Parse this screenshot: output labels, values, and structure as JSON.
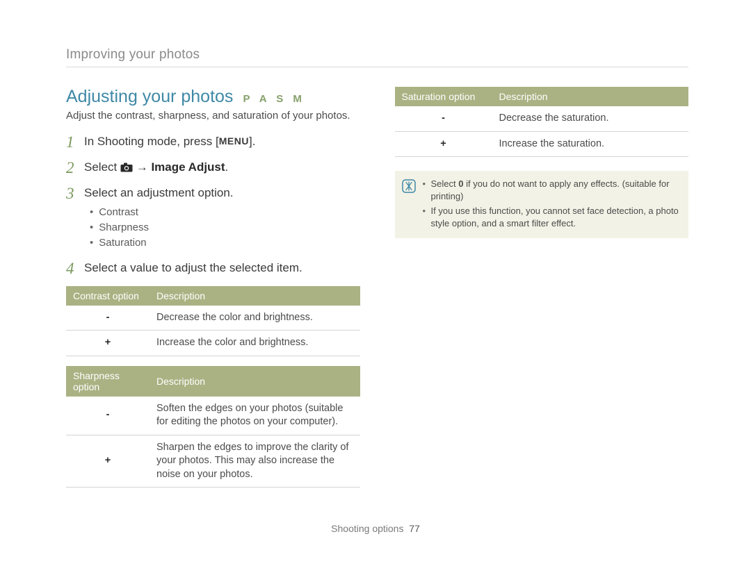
{
  "breadcrumb": "Improving your photos",
  "section": {
    "title": "Adjusting your photos",
    "modes": "P A S M",
    "intro": "Adjust the contrast, sharpness, and saturation of your photos."
  },
  "steps": {
    "s1_prefix": "In Shooting mode, press [",
    "s1_menu": "MENU",
    "s1_suffix": "].",
    "s2_prefix": "Select ",
    "s2_arrow": " → ",
    "s2_bold": "Image Adjust",
    "s2_suffix": ".",
    "s3": "Select an adjustment option.",
    "s3_bullets": [
      "Contrast",
      "Sharpness",
      "Saturation"
    ],
    "s4": "Select a value to adjust the selected item."
  },
  "tables": {
    "contrast": {
      "headers": [
        "Contrast option",
        "Description"
      ],
      "rows": [
        {
          "sym": "-",
          "desc": "Decrease the color and brightness."
        },
        {
          "sym": "+",
          "desc": "Increase the color and brightness."
        }
      ]
    },
    "sharpness": {
      "headers": [
        "Sharpness option",
        "Description"
      ],
      "rows": [
        {
          "sym": "-",
          "desc": "Soften the edges on your photos (suitable for editing the photos on your computer)."
        },
        {
          "sym": "+",
          "desc": "Sharpen the edges to improve the clarity of your photos. This may also increase the noise on your photos."
        }
      ]
    },
    "saturation": {
      "headers": [
        "Saturation option",
        "Description"
      ],
      "rows": [
        {
          "sym": "-",
          "desc": "Decrease the saturation."
        },
        {
          "sym": "+",
          "desc": "Increase the saturation."
        }
      ]
    }
  },
  "note": {
    "items": [
      {
        "pre": "Select ",
        "bold": "0",
        "post": " if you do not want to apply any effects. (suitable for printing)"
      },
      {
        "pre": "If you use this function, you cannot set face detection, a photo style option, and a smart filter effect.",
        "bold": "",
        "post": ""
      }
    ]
  },
  "footer": {
    "label": "Shooting options",
    "page": "77"
  }
}
